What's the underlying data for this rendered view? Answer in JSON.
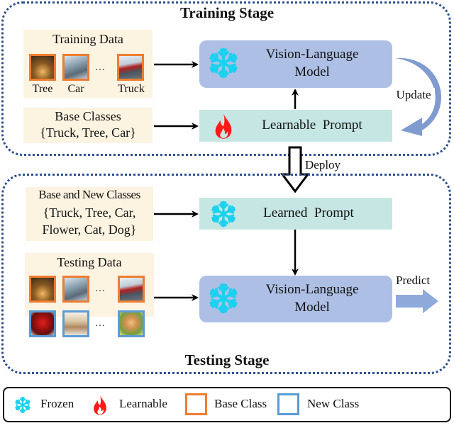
{
  "training_stage": {
    "title": "Training Stage",
    "training_data": {
      "title": "Training Data",
      "images": [
        {
          "caption": "Tree",
          "class_type": "base"
        },
        {
          "caption": "Car",
          "class_type": "base"
        },
        {
          "caption": "Truck",
          "class_type": "base"
        }
      ],
      "ellipsis": "…"
    },
    "base_classes": {
      "title": "Base Classes",
      "list": "{Truck, Tree, Car}"
    },
    "vlm": {
      "line1": "Vision-Language",
      "line2": "Model",
      "icon": "snowflake-icon"
    },
    "prompt": {
      "label": "Learnable  Prompt",
      "icon": "flame-icon"
    },
    "update_label": "Update"
  },
  "deploy_label": "Deploy",
  "testing_stage": {
    "title": "Testing Stage",
    "classes": {
      "title": "Base and New Classes",
      "line1": "{Truck, Tree, Car,",
      "line2": "Flower, Cat, Dog}"
    },
    "prompt": {
      "label": "Learned  Prompt",
      "icon": "snowflake-icon"
    },
    "testing_data": {
      "title": "Testing Data",
      "rows": [
        {
          "class_type": "base",
          "images": [
            "tree",
            "car",
            "truck"
          ]
        },
        {
          "class_type": "new",
          "images": [
            "flower",
            "cat",
            "dog"
          ]
        }
      ],
      "ellipsis": "…"
    },
    "vlm": {
      "line1": "Vision-Language",
      "line2": "Model",
      "icon": "snowflake-icon"
    },
    "predict_label": "Predict"
  },
  "legend": {
    "items": [
      {
        "label": "Frozen",
        "icon": "snowflake-icon"
      },
      {
        "label": "Learnable",
        "icon": "flame-icon"
      },
      {
        "label": "Base Class",
        "icon": "orange-box",
        "color": "#ee7d31"
      },
      {
        "label": "New Class",
        "icon": "blue-box",
        "color": "#5b9bd5"
      }
    ]
  },
  "colors": {
    "stage_border": "#2e4f8c",
    "vlm_fill": "#adbfe4",
    "prompt_fill": "#c6e6e3",
    "data_fill": "#fdf3e1",
    "base_class": "#ee7d31",
    "new_class": "#5b9bd5",
    "snowflake": "#1ad1f0",
    "flame": "#ff1a1a",
    "update_arrow": "#7f9bd0"
  }
}
